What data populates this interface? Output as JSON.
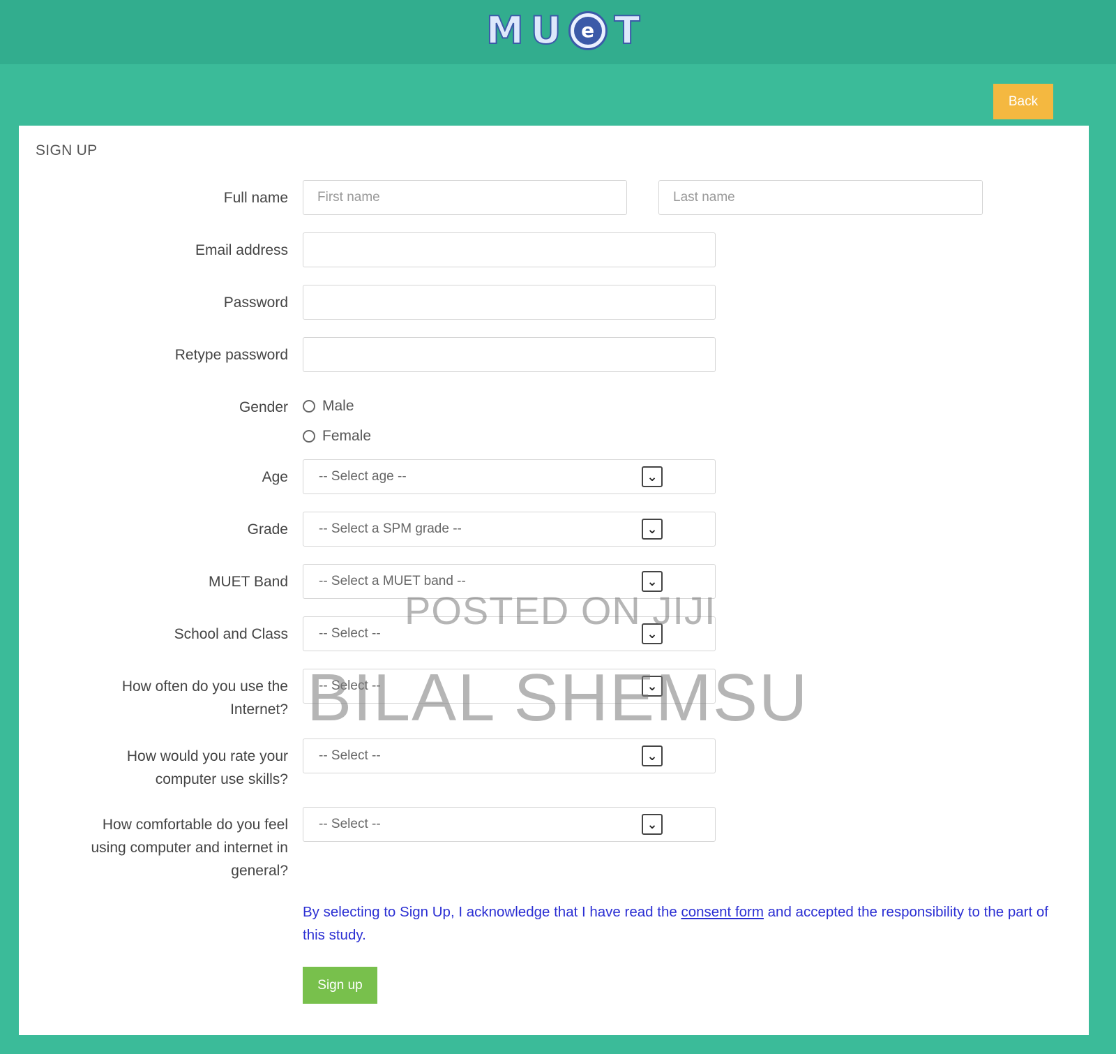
{
  "header": {
    "logo_letters": [
      "M",
      "U",
      "e",
      "T"
    ]
  },
  "back_button": "Back",
  "form": {
    "title": "SIGN UP",
    "full_name_label": "Full name",
    "first_name_placeholder": "First name",
    "last_name_placeholder": "Last name",
    "email_label": "Email address",
    "password_label": "Password",
    "retype_label": "Retype password",
    "gender_label": "Gender",
    "gender_options": [
      "Male",
      "Female"
    ],
    "age_label": "Age",
    "age_value": "-- Select age --",
    "grade_label": "Grade",
    "grade_value": "-- Select a SPM grade --",
    "muet_label": "MUET Band",
    "muet_value": "-- Select a MUET band --",
    "school_label": "School and Class",
    "school_value": "-- Select --",
    "internet_label_1": "How often do you use the",
    "internet_label_2": "Internet?",
    "internet_value": "-- Select --",
    "skills_label_1": "How would you rate your",
    "skills_label_2": "computer use skills?",
    "skills_value": "-- Select --",
    "comfort_label_1": "How comfortable do you feel",
    "comfort_label_2": "using computer and internet in",
    "comfort_label_3": "general?",
    "comfort_value": "-- Select --",
    "consent_before": "By selecting to Sign Up, I acknowledge that I have read the ",
    "consent_link": "consent form",
    "consent_after": " and accepted the responsibility to the part of this study.",
    "signup_button": "Sign up"
  },
  "watermark": {
    "line1": "POSTED ON JIJI",
    "line2": "BILAL SHEMSU"
  },
  "colors": {
    "background": "#3bbb99",
    "header": "#32ad8e",
    "back_button": "#f4b840",
    "signup_button": "#78c04c",
    "consent_text": "#2b2fd3"
  }
}
